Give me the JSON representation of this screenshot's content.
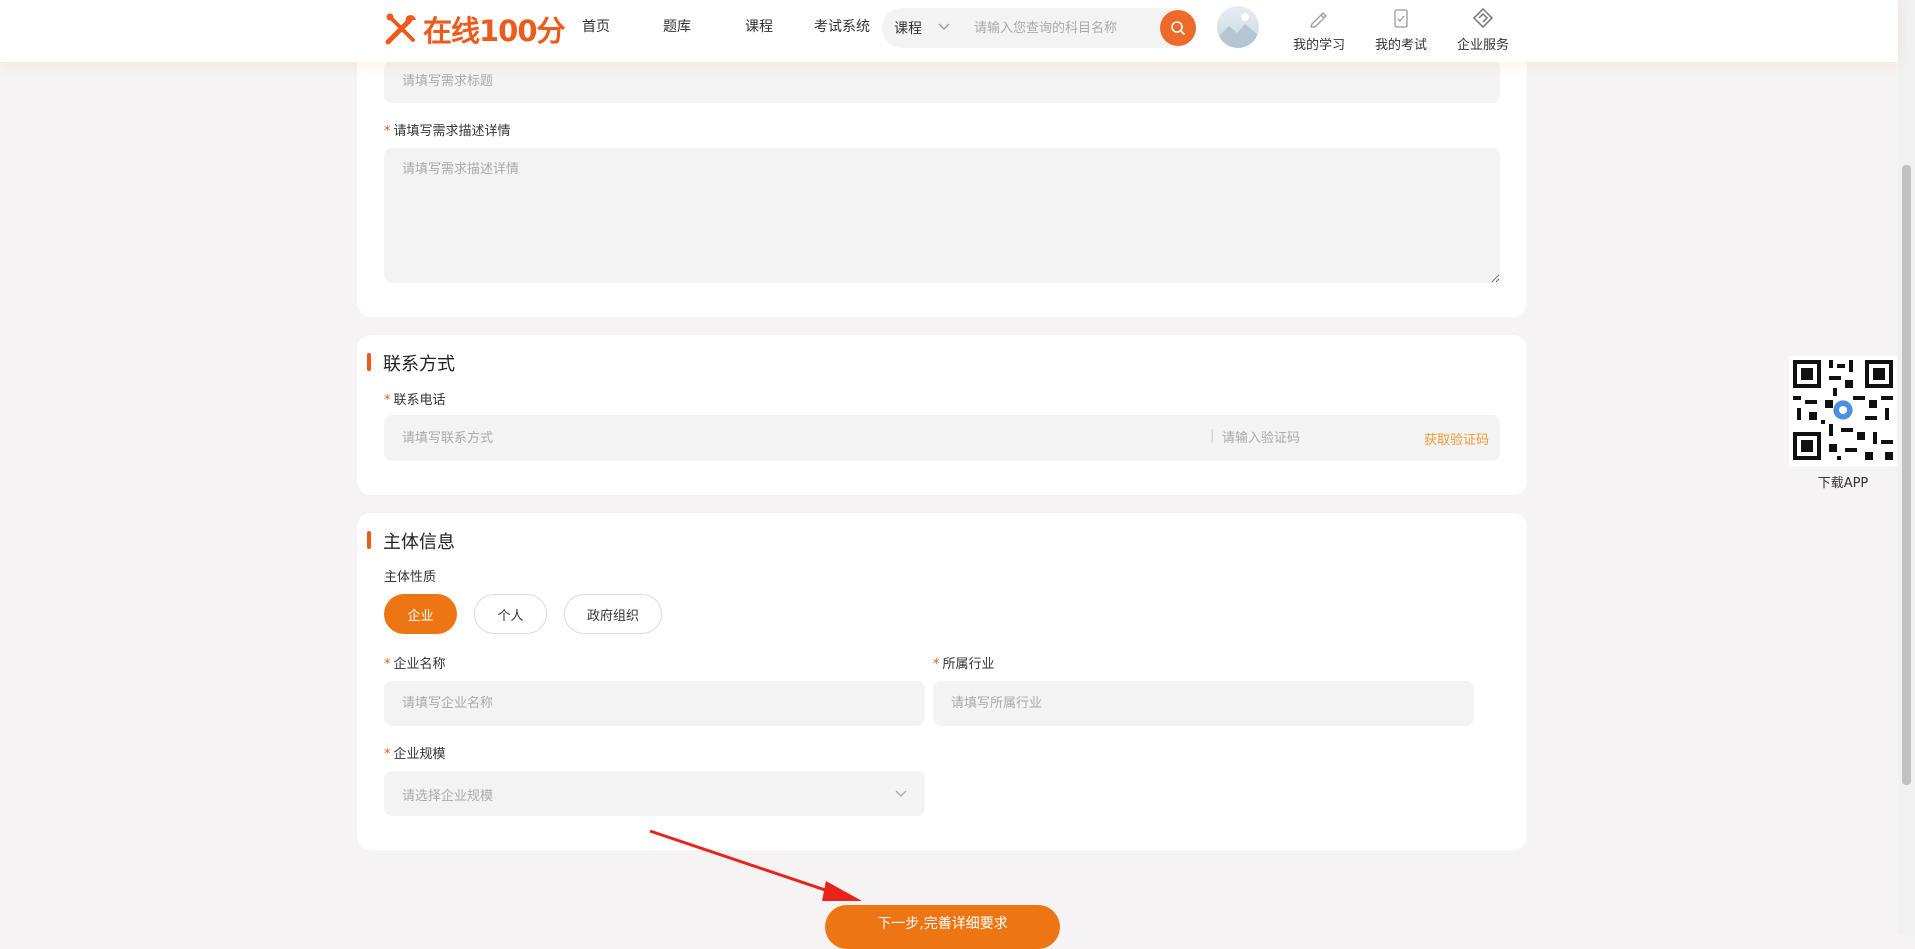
{
  "header": {
    "logo_text": "在线100分",
    "nav": [
      "首页",
      "题库",
      "课程",
      "考试系统"
    ],
    "search": {
      "category": "课程",
      "placeholder": "请输入您查询的科目名称"
    },
    "icons": [
      {
        "label": "我的学习",
        "icon": "pencil-icon"
      },
      {
        "label": "我的考试",
        "icon": "clipboard-icon"
      },
      {
        "label": "企业服务",
        "icon": "diamond-link-icon"
      }
    ]
  },
  "demand": {
    "title_placeholder": "请填写需求标题",
    "detail_label": "请填写需求描述详情",
    "detail_placeholder": "请填写需求描述详情"
  },
  "contact": {
    "section_title": "联系方式",
    "phone_label": "联系电话",
    "phone_placeholder": "请填写联系方式",
    "code_placeholder": "请输入验证码",
    "get_code": "获取验证码"
  },
  "entity": {
    "section_title": "主体信息",
    "type_label": "主体性质",
    "types": [
      "企业",
      "个人",
      "政府组织"
    ],
    "selected_type": "企业",
    "company_name_label": "企业名称",
    "company_name_placeholder": "请填写企业名称",
    "industry_label": "所属行业",
    "industry_placeholder": "请填写所属行业",
    "scale_label": "企业规模",
    "scale_placeholder": "请选择企业规模"
  },
  "sidebar": {
    "download_label": "下载APP"
  },
  "submit": {
    "label": "下一步,完善详细要求"
  },
  "colors": {
    "brand": "#ec5a1c",
    "button": "#ed7514",
    "field_bg": "#f3f3f3",
    "page_bg": "#f5f3f3"
  }
}
